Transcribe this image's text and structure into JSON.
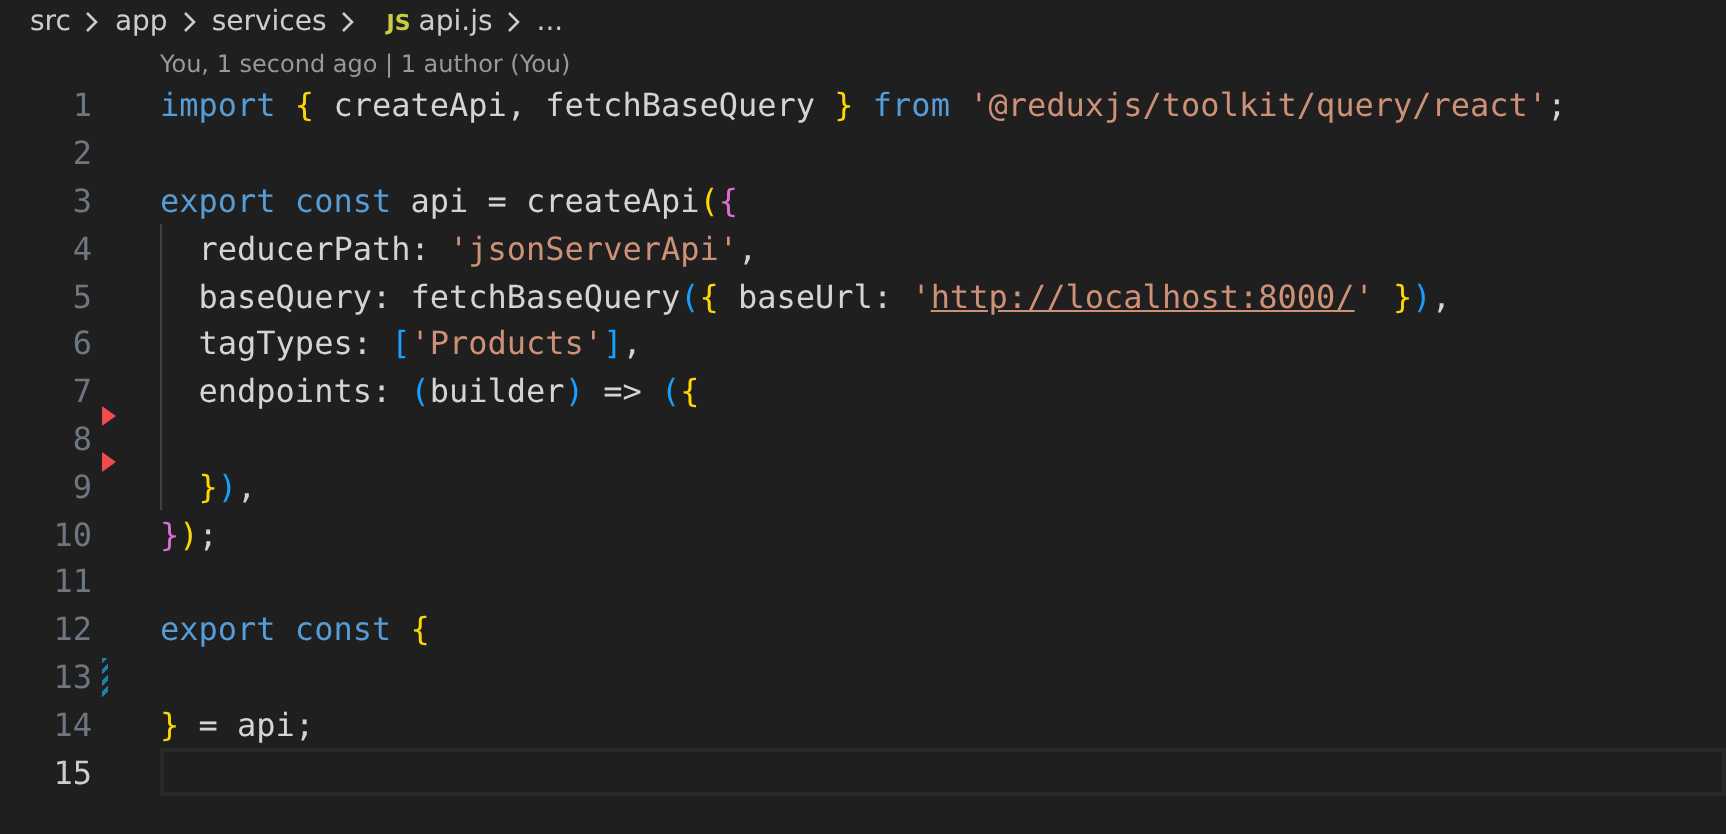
{
  "breadcrumb": [
    {
      "label": "src",
      "kind": "folder"
    },
    {
      "label": "app",
      "kind": "folder"
    },
    {
      "label": "services",
      "kind": "folder"
    },
    {
      "label": "api.js",
      "kind": "file",
      "badge": "JS"
    },
    {
      "label": "...",
      "kind": "more"
    }
  ],
  "codelens": "You, 1 second ago | 1 author (You)",
  "lines": [
    {
      "number": "1",
      "selected": false,
      "tokens": [
        {
          "t": "import",
          "kind": "keyword"
        },
        {
          "t": " {",
          "kind": "bracket1"
        },
        {
          "t": " createApi, fetchBaseQuery",
          "kind": "plain"
        },
        {
          "t": " }",
          "kind": "bracket1"
        },
        {
          "t": " from",
          "kind": "keyword"
        },
        {
          "t": " '@reduxjs/toolkit/query/react'",
          "kind": "string"
        },
        {
          "t": ";",
          "kind": "plain"
        }
      ]
    },
    {
      "number": "2",
      "selected": false
    },
    {
      "number": "3",
      "selected": false,
      "tokens": [
        {
          "t": "export",
          "kind": "keyword"
        },
        {
          "t": " const",
          "kind": "keyword"
        },
        {
          "t": " api = createApi",
          "kind": "plain"
        },
        {
          "t": "(",
          "kind": "bracket1"
        },
        {
          "t": "{",
          "kind": "bracket2"
        }
      ]
    },
    {
      "number": "4",
      "selected": false,
      "indent_guide": true,
      "tokens": [
        {
          "t": "  reducerPath: ",
          "kind": "plain"
        },
        {
          "t": "'jsonServerApi'",
          "kind": "string"
        },
        {
          "t": ",",
          "kind": "plain"
        }
      ]
    },
    {
      "number": "5",
      "selected": false,
      "indent_guide": true,
      "tokens": [
        {
          "t": "  baseQuery: fetchBaseQuery",
          "kind": "plain"
        },
        {
          "t": "(",
          "kind": "bracket3"
        },
        {
          "t": "{",
          "kind": "bracket1"
        },
        {
          "t": " baseUrl: ",
          "kind": "plain"
        },
        {
          "t": "'",
          "kind": "string"
        },
        {
          "t": "http://localhost:8000/",
          "kind": "link"
        },
        {
          "t": "'",
          "kind": "string"
        },
        {
          "t": " }",
          "kind": "bracket1"
        },
        {
          "t": ")",
          "kind": "bracket3"
        },
        {
          "t": ",",
          "kind": "plain"
        }
      ]
    },
    {
      "number": "6",
      "selected": false,
      "indent_guide": true,
      "tokens": [
        {
          "t": "  tagTypes: ",
          "kind": "plain"
        },
        {
          "t": "[",
          "kind": "bracket3"
        },
        {
          "t": "'Products'",
          "kind": "string"
        },
        {
          "t": "]",
          "kind": "bracket3"
        },
        {
          "t": ",",
          "kind": "plain"
        }
      ]
    },
    {
      "number": "7",
      "selected": false,
      "indent_guide": true,
      "tokens": [
        {
          "t": "  endpoints: ",
          "kind": "plain"
        },
        {
          "t": "(",
          "kind": "bracket3"
        },
        {
          "t": "builder",
          "kind": "plain"
        },
        {
          "t": ")",
          "kind": "bracket3"
        },
        {
          "t": " => ",
          "kind": "plain"
        },
        {
          "t": "(",
          "kind": "bracket3"
        },
        {
          "t": "{",
          "kind": "bracket1"
        }
      ]
    },
    {
      "number": "8",
      "selected": false,
      "indent_guide": true,
      "deleted_above": true
    },
    {
      "number": "9",
      "selected": false,
      "indent_guide": true,
      "deleted_above": true,
      "tokens": [
        {
          "t": "  }",
          "kind": "bracket1"
        },
        {
          "t": ")",
          "kind": "bracket3"
        },
        {
          "t": ",",
          "kind": "plain"
        }
      ]
    },
    {
      "number": "10",
      "selected": false,
      "tokens": [
        {
          "t": "}",
          "kind": "bracket2"
        },
        {
          "t": ")",
          "kind": "bracket1"
        },
        {
          "t": ";",
          "kind": "plain"
        }
      ]
    },
    {
      "number": "11",
      "selected": false
    },
    {
      "number": "12",
      "selected": false,
      "tokens": [
        {
          "t": "export",
          "kind": "keyword"
        },
        {
          "t": " const",
          "kind": "keyword"
        },
        {
          "t": " {",
          "kind": "bracket1"
        }
      ]
    },
    {
      "number": "13",
      "selected": false,
      "added": true
    },
    {
      "number": "14",
      "selected": false,
      "tokens": [
        {
          "t": "}",
          "kind": "bracket1"
        },
        {
          "t": " = api;",
          "kind": "plain"
        }
      ]
    },
    {
      "number": "15",
      "selected": true
    }
  ]
}
